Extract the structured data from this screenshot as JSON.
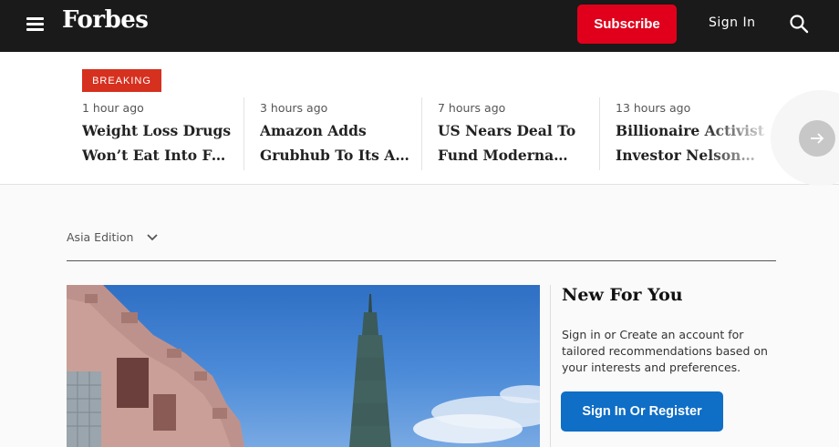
{
  "header": {
    "logo": "Forbes",
    "subscribe_label": "Subscribe",
    "signin_label": "Sign In",
    "icons": [
      "menu-icon",
      "search-icon"
    ]
  },
  "breaking": {
    "badge": "BREAKING",
    "stories": [
      {
        "time": "1 hour ago",
        "line1": "Weight Loss Drugs",
        "line2": "Won’t Eat Into Foo…"
      },
      {
        "time": "3 hours ago",
        "line1": "Amazon Adds",
        "line2": "Grubhub To Its Ap…"
      },
      {
        "time": "7 hours ago",
        "line1": "US Nears Deal To",
        "line2": "Fund Moderna…"
      },
      {
        "time": "13 hours ago",
        "line1": "Billionaire Activist",
        "line2": "Investor Nelson…"
      }
    ],
    "next_icon": "arrow-right-icon"
  },
  "main": {
    "edition_label": "Asia Edition",
    "new_for_you": {
      "title": "New For You",
      "text": "Sign in or Create an account for tailored recommendations based on your interests and preferences.",
      "button": "Sign In Or Register"
    }
  },
  "colors": {
    "header_bg": "#1a1a1a",
    "subscribe": "#e0001b",
    "breaking": "#d6301f",
    "register": "#0f6ec6"
  }
}
